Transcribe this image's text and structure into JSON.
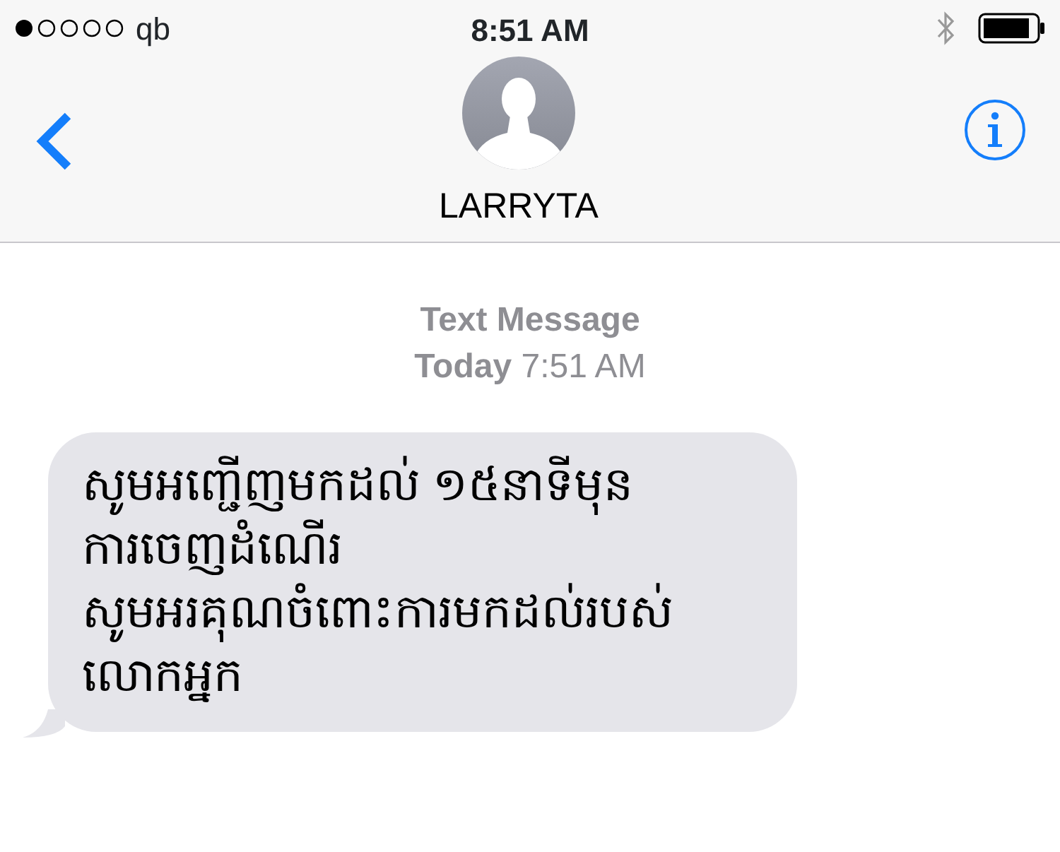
{
  "status_bar": {
    "carrier": "qb",
    "time": "8:51 AM"
  },
  "header": {
    "contact_name": "LARRYTA"
  },
  "thread": {
    "service": "Text Message",
    "date": "Today",
    "time": "7:51 AM",
    "messages": [
      {
        "lines": [
          "សូមអញ្ជើញមកដល់ ១៥នាទីមុន",
          "ការចេញដំណើរ",
          "សូមអរគុណចំពោះការមកដល់របស់",
          "លោកអ្នក"
        ]
      }
    ]
  }
}
